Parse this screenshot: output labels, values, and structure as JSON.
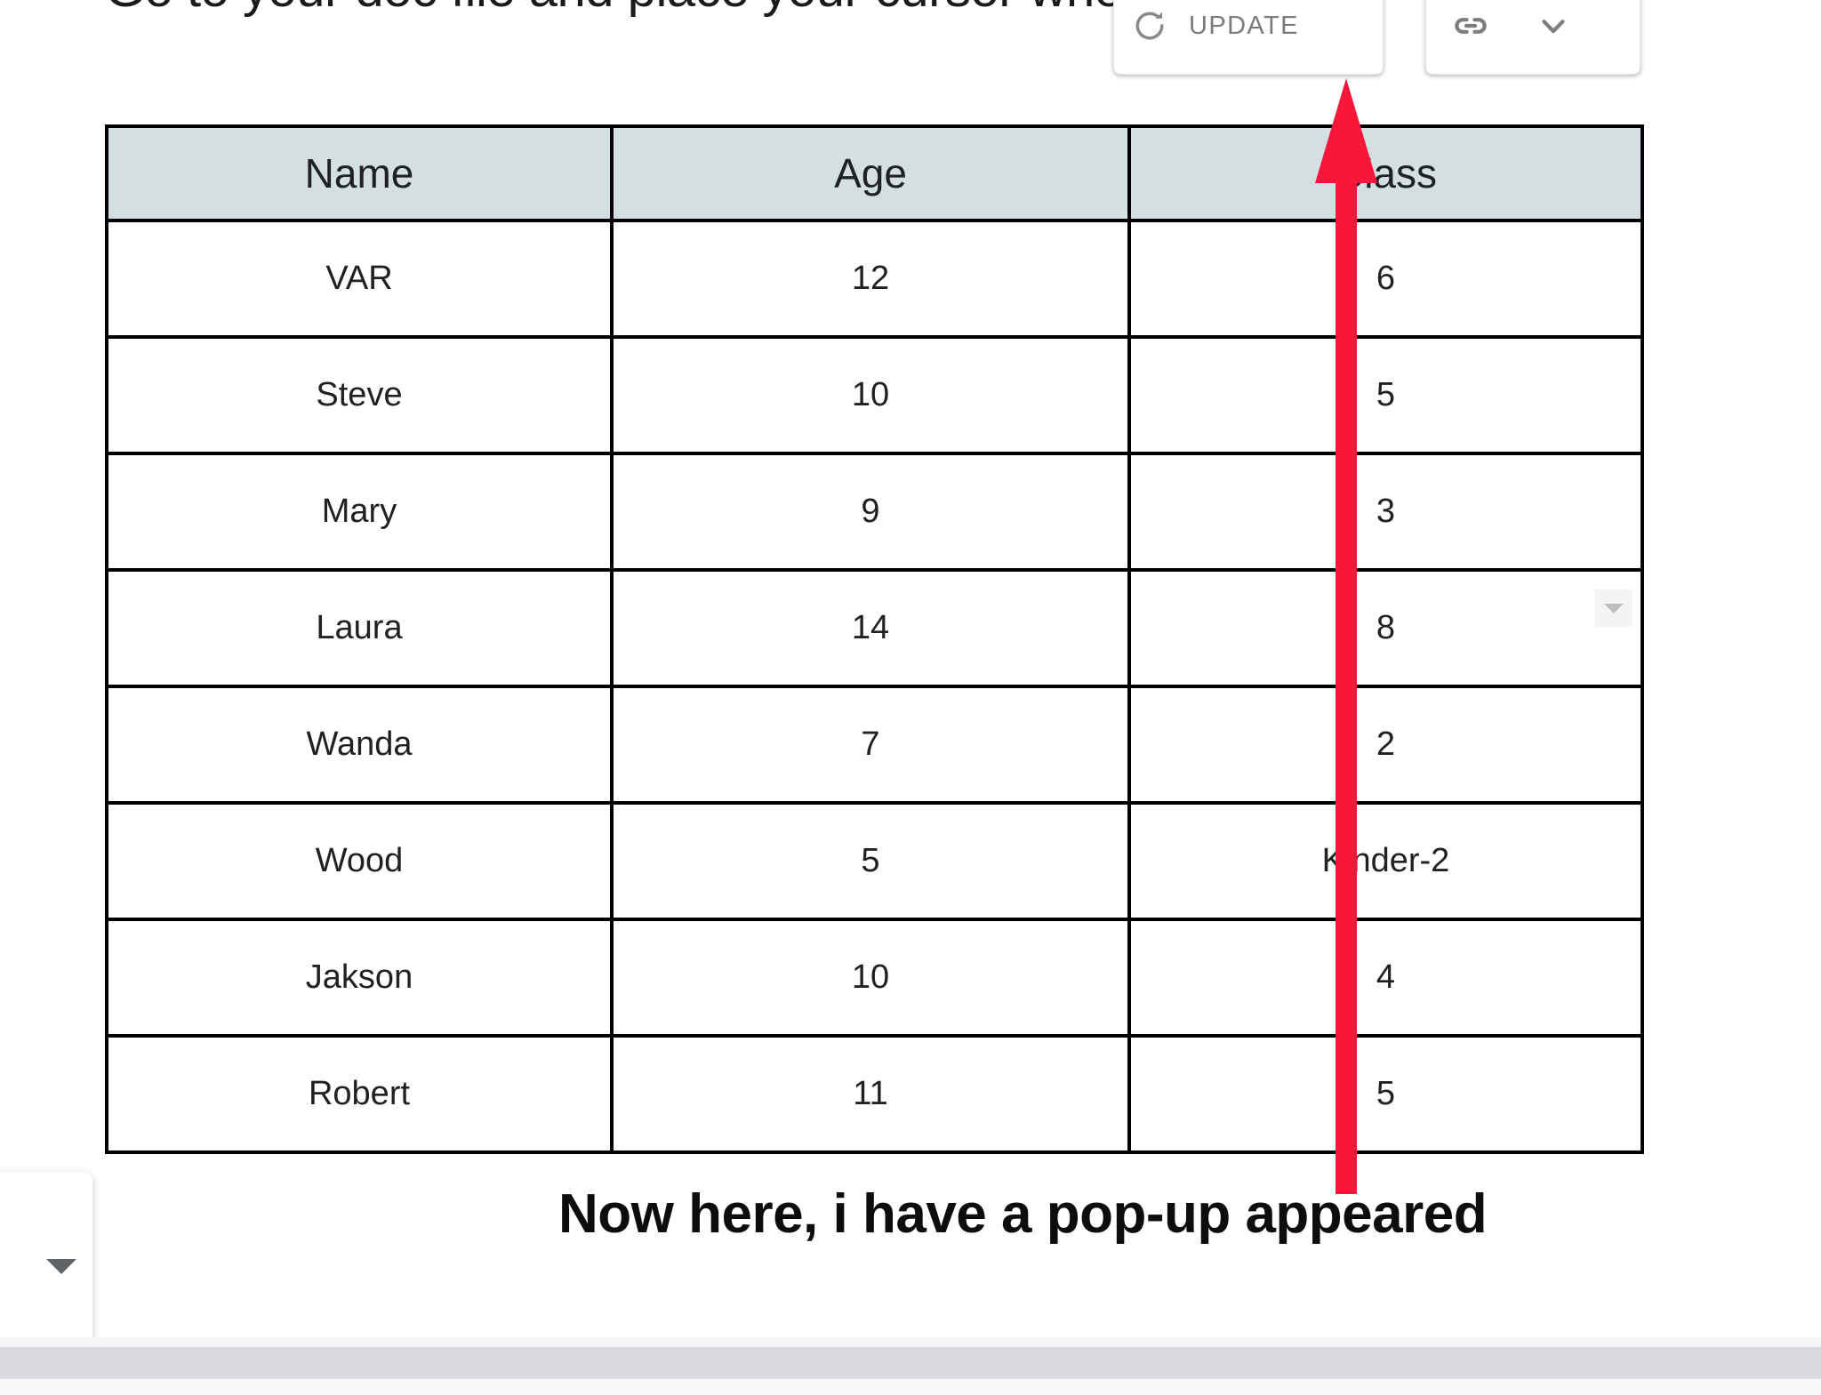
{
  "document": {
    "heading_text": "Go to your doc file and place your cursor where you"
  },
  "update_popup": {
    "refresh_icon": "refresh-icon",
    "update_label": "UPDATE"
  },
  "linked_popup": {
    "link_icon": "link-icon",
    "chevron_icon": "chevron-down-icon"
  },
  "cell_widget": {
    "dropdown_icon": "dropdown-triangle-icon"
  },
  "table": {
    "headers": [
      "Name",
      "Age",
      "Class"
    ],
    "rows": [
      [
        "VAR",
        "12",
        "6"
      ],
      [
        "Steve",
        "10",
        "5"
      ],
      [
        "Mary",
        "9",
        "3"
      ],
      [
        "Laura",
        "14",
        "8"
      ],
      [
        "Wanda",
        "7",
        "2"
      ],
      [
        "Wood",
        "5",
        "Kinder-2"
      ],
      [
        "Jakson",
        "10",
        "4"
      ],
      [
        "Robert",
        "11",
        "5"
      ]
    ]
  },
  "annotation": {
    "caption": "Now here, i have a pop-up appeared",
    "arrow_color": "#F8173A"
  },
  "colors": {
    "header_fill": "#d3dfe1",
    "table_border": "#000000",
    "popup_text": "#7b7b7b",
    "accent_red": "#F8173A"
  }
}
